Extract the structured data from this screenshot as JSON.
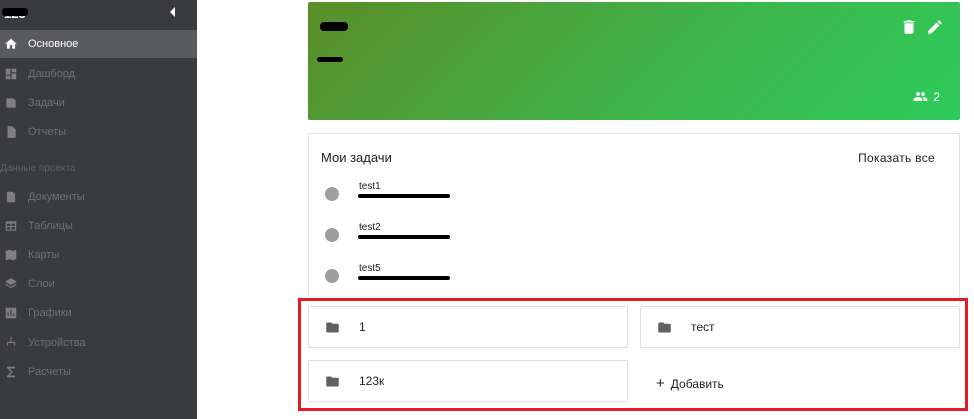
{
  "sidebar": {
    "title": "123",
    "items": [
      {
        "label": "Основное",
        "icon": "home-icon"
      },
      {
        "label": "Дашборд",
        "icon": "dashboard-icon"
      },
      {
        "label": "Задачи",
        "icon": "tasks-icon"
      },
      {
        "label": "Отчеты",
        "icon": "report-icon"
      },
      {
        "label": "Документы",
        "icon": "document-icon"
      },
      {
        "label": "Таблицы",
        "icon": "table-icon"
      },
      {
        "label": "Карты",
        "icon": "map-icon"
      },
      {
        "label": "Слои",
        "icon": "layers-icon"
      },
      {
        "label": "Графики",
        "icon": "chart-icon"
      },
      {
        "label": "Устройства",
        "icon": "devices-icon"
      },
      {
        "label": "Расчеты",
        "icon": "sigma-icon"
      }
    ],
    "section_label": "Данные проекта"
  },
  "project": {
    "members_count": "2",
    "colors": {
      "gradient_start": "#5a8d28",
      "gradient_end": "#2ecb5c"
    }
  },
  "tasks": {
    "title": "Мои задачи",
    "show_all": "Показать все",
    "items": [
      {
        "name": "test1"
      },
      {
        "name": "test2"
      },
      {
        "name": "test5"
      }
    ]
  },
  "folders": {
    "items": [
      {
        "label": "1"
      },
      {
        "label": "тест"
      },
      {
        "label": "123к"
      }
    ],
    "add_label": "Добавить",
    "highlight_color": "#e31b23"
  }
}
